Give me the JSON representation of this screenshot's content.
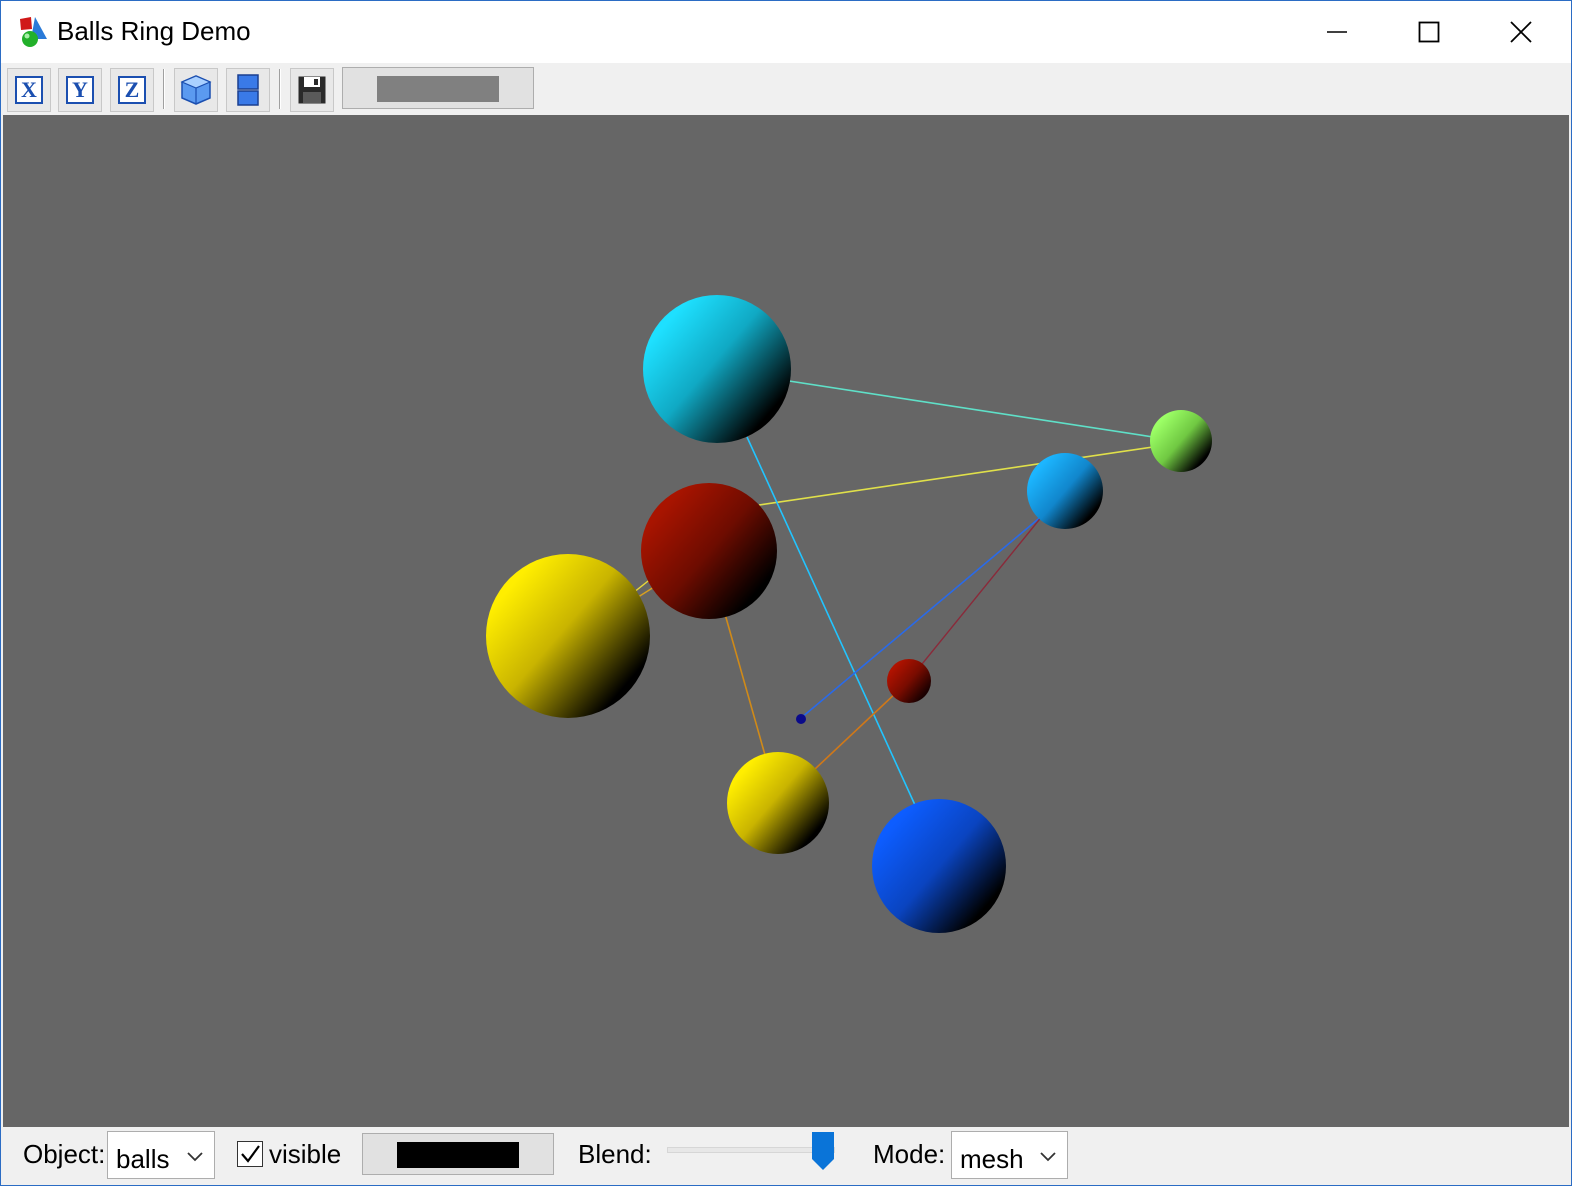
{
  "window": {
    "title": "Balls Ring Demo",
    "buttons": [
      "minimize",
      "maximize",
      "close"
    ]
  },
  "toolbar": {
    "view_x_label": "X",
    "view_y_label": "Y",
    "view_z_label": "Z",
    "icons": [
      "view-x-icon",
      "view-y-icon",
      "view-z-icon",
      "cube-view-icon",
      "split-view-icon",
      "save-icon"
    ],
    "background_color": "#808080"
  },
  "viewport": {
    "background_color": "#666666",
    "balls": [
      {
        "name": "cyan-ball",
        "color": "#19d6f5"
      },
      {
        "name": "green-ball",
        "color": "#8ef25a"
      },
      {
        "name": "light-blue-ball",
        "color": "#17a8f2"
      },
      {
        "name": "dark-red-ball",
        "color": "#990e00"
      },
      {
        "name": "yellow-ball-large",
        "color": "#fbe600"
      },
      {
        "name": "small-red-ball",
        "color": "#9e0c00"
      },
      {
        "name": "tiny-navy-ball",
        "color": "#0a0a8a"
      },
      {
        "name": "yellow-ball-small",
        "color": "#fbe600"
      },
      {
        "name": "blue-ball",
        "color": "#0a55f5"
      }
    ]
  },
  "bottom": {
    "object_label": "Object:",
    "object_value": "balls",
    "visible_label": "visible",
    "visible_checked": true,
    "object_color": "#000000",
    "blend_label": "Blend:",
    "blend_value": 1.0,
    "mode_label": "Mode:",
    "mode_value": "mesh"
  }
}
